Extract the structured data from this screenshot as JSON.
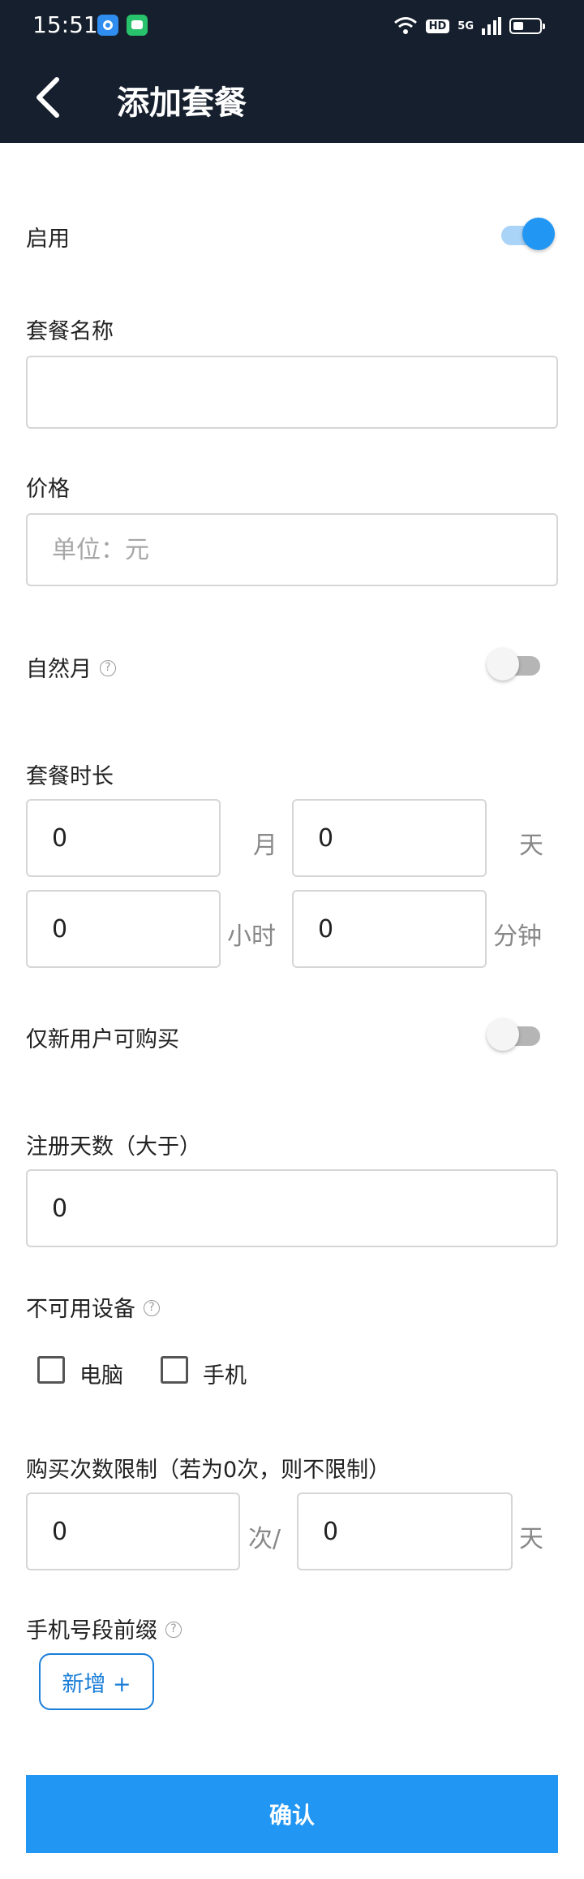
{
  "status_bar": {
    "time": "15:51",
    "hd": "HD",
    "network": "5G"
  },
  "header": {
    "title": "添加套餐"
  },
  "form": {
    "enable": {
      "label": "启用",
      "on": true
    },
    "package_name": {
      "label": "套餐名称",
      "value": "",
      "placeholder": ""
    },
    "price": {
      "label": "价格",
      "value": "",
      "placeholder": "单位：元"
    },
    "natural_month": {
      "label": "自然月",
      "on": false,
      "help": "?"
    },
    "duration": {
      "label": "套餐时长",
      "month": {
        "value": "0",
        "unit": "月"
      },
      "day": {
        "value": "0",
        "unit": "天"
      },
      "hour": {
        "value": "0",
        "unit": "小时"
      },
      "minute": {
        "value": "0",
        "unit": "分钟"
      }
    },
    "new_users_only": {
      "label": "仅新用户可购买",
      "on": false
    },
    "register_days": {
      "label": "注册天数（大于）",
      "value": "0"
    },
    "unavailable_devices": {
      "label": "不可用设备",
      "help": "?",
      "options": [
        {
          "label": "电脑",
          "checked": false
        },
        {
          "label": "手机",
          "checked": false
        }
      ]
    },
    "purchase_limit": {
      "label": "购买次数限制（若为0次，则不限制）",
      "count": {
        "value": "0",
        "unit": "次/"
      },
      "days": {
        "value": "0",
        "unit": "天"
      }
    },
    "phone_prefix": {
      "label": "手机号段前缀",
      "help": "?",
      "add_label": "新增 +"
    }
  },
  "actions": {
    "confirm_label": "确认"
  },
  "colors": {
    "header_bg": "#161f2d",
    "accent": "#2196f3",
    "add_button": "#1a7ed8"
  }
}
